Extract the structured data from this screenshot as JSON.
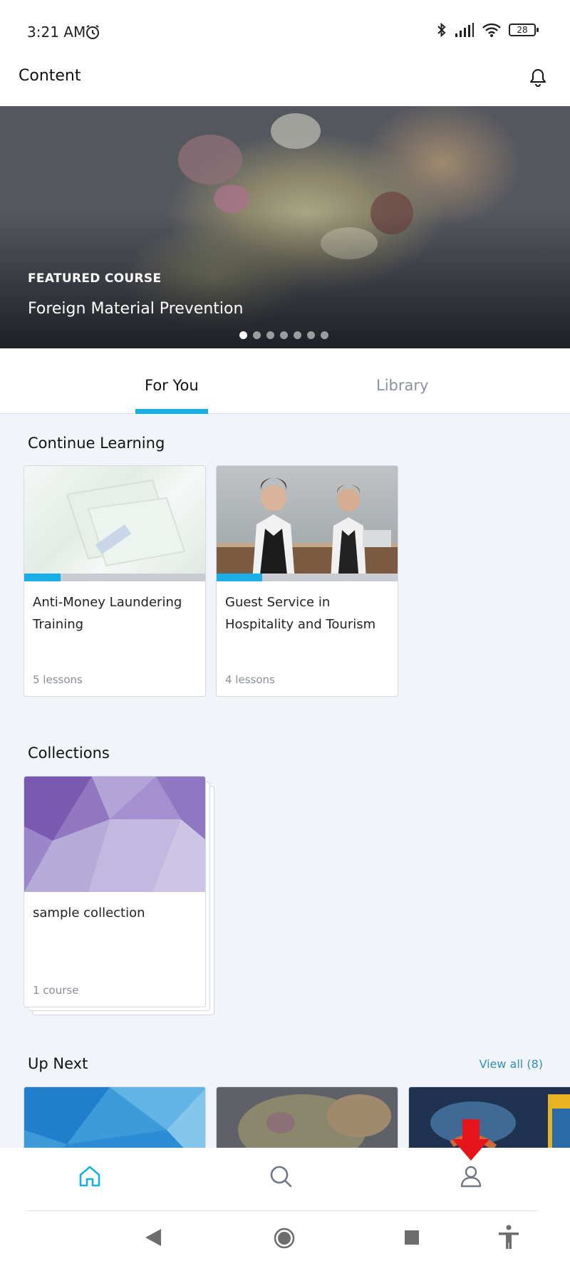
{
  "status_bar": {
    "time": "3:21 AM",
    "battery": "28"
  },
  "header": {
    "title": "Content",
    "notification_icon": "bell-icon"
  },
  "hero": {
    "kicker": "FEATURED COURSE",
    "title": "Foreign Material Prevention",
    "slide_count": 7,
    "active_slide": 1
  },
  "tabs": [
    {
      "label": "For You",
      "active": true
    },
    {
      "label": "Library",
      "active": false
    }
  ],
  "continue_learning": {
    "title": "Continue Learning",
    "items": [
      {
        "title": "Anti-Money Laundering Training",
        "meta": "5 lessons",
        "progress": 0.2
      },
      {
        "title": "Guest Service in Hospitality and Tourism",
        "meta": "4 lessons",
        "progress": 0.25
      }
    ]
  },
  "collections": {
    "title": "Collections",
    "items": [
      {
        "title": "sample collection",
        "meta": "1 course"
      }
    ]
  },
  "up_next": {
    "title": "Up Next",
    "view_all": "View all (8)"
  },
  "bottom_nav": {
    "items": [
      "home-icon",
      "search-icon",
      "profile-icon"
    ],
    "active": "home-icon"
  },
  "colors": {
    "accent": "#19aee6",
    "link": "#2f8fb8",
    "annotation_arrow": "#e8141b"
  }
}
